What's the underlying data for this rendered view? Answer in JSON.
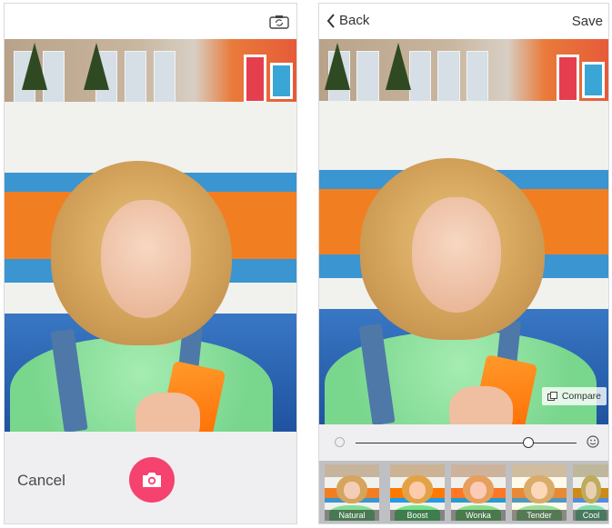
{
  "left_screen": {
    "cancel_label": "Cancel",
    "camera_switch_icon": "camera-switch-icon",
    "shutter_icon": "camera-icon"
  },
  "right_screen": {
    "back_label": "Back",
    "save_label": "Save",
    "compare_label": "Compare",
    "slider_value": 0.78,
    "filters": [
      {
        "label": "Natural",
        "selected": true
      },
      {
        "label": "Boost",
        "selected": false
      },
      {
        "label": "Wonka",
        "selected": false
      },
      {
        "label": "Tender",
        "selected": false
      },
      {
        "label": "Cool",
        "selected": false
      }
    ]
  },
  "colors": {
    "accent_pink": "#f5426f",
    "selected_outline": "#f05f6f"
  }
}
